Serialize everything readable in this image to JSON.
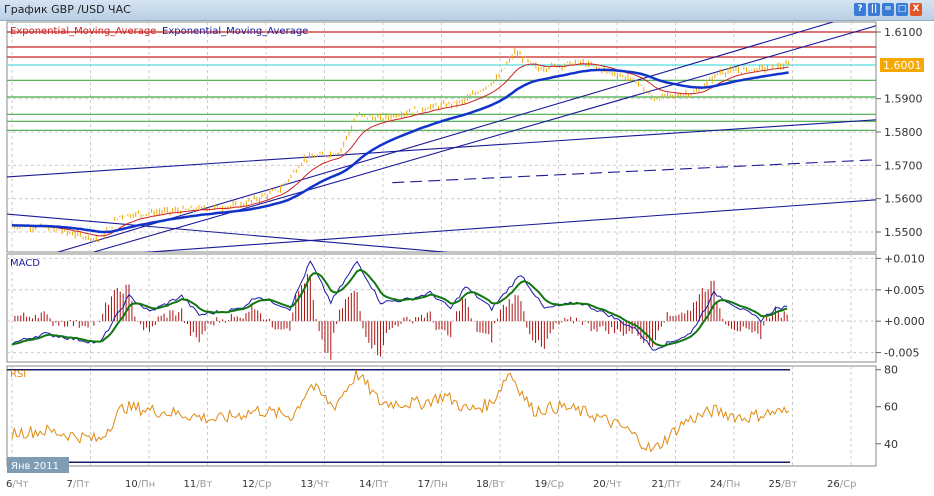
{
  "window": {
    "title": "График GBP /USD  ЧАС",
    "buttons": [
      "?",
      "||",
      "=",
      "□",
      "X"
    ]
  },
  "chart_data": [
    {
      "type": "line",
      "title": "GBP/USD",
      "legend": [
        "Exponential_Moving_Average",
        "Exponential_Moving_Average"
      ],
      "ylim": [
        1.544,
        1.613
      ],
      "y_ticks": [
        "1.6100",
        "1.5900",
        "1.5800",
        "1.5700",
        "1.5600",
        "1.5500"
      ],
      "current_price": "1.6001",
      "x_ticks": [
        {
          "d": "6",
          "w": "Чт"
        },
        {
          "d": "7",
          "w": "Пт"
        },
        {
          "d": "10",
          "w": "Пн"
        },
        {
          "d": "11",
          "w": "Вт"
        },
        {
          "d": "12",
          "w": "Ср"
        },
        {
          "d": "13",
          "w": "Чт"
        },
        {
          "d": "14",
          "w": "Пт"
        },
        {
          "d": "17",
          "w": "Пн"
        },
        {
          "d": "18",
          "w": "Вт"
        },
        {
          "d": "19",
          "w": "Ср"
        },
        {
          "d": "20",
          "w": "Чт"
        },
        {
          "d": "21",
          "w": "Пт"
        },
        {
          "d": "24",
          "w": "Пн"
        },
        {
          "d": "25",
          "w": "Вт"
        },
        {
          "d": "26",
          "w": "Ср"
        }
      ],
      "month_label": "Янв 2011",
      "price_path": [
        [
          0,
          1.552
        ],
        [
          0.5,
          1.5515
        ],
        [
          1.5,
          1.5478
        ],
        [
          1.85,
          1.555
        ],
        [
          2.9,
          1.5565
        ],
        [
          3.9,
          1.558
        ],
        [
          4.6,
          1.563
        ],
        [
          5.0,
          1.572
        ],
        [
          5.6,
          1.574
        ],
        [
          5.9,
          1.585
        ],
        [
          6.3,
          1.584
        ],
        [
          7.0,
          1.587
        ],
        [
          7.7,
          1.589
        ],
        [
          8.3,
          1.596
        ],
        [
          8.6,
          1.604
        ],
        [
          9.0,
          1.599
        ],
        [
          9.7,
          1.601
        ],
        [
          10.4,
          1.597
        ],
        [
          10.7,
          1.595
        ],
        [
          10.95,
          1.59
        ],
        [
          11.7,
          1.592
        ],
        [
          12.1,
          1.598
        ],
        [
          12.8,
          1.599
        ],
        [
          13.3,
          1.6001
        ]
      ],
      "hlines": [
        {
          "p": 1.61,
          "c": "#cc2222"
        },
        {
          "p": 1.6055,
          "c": "#cc2222"
        },
        {
          "p": 1.6025,
          "c": "#cc2222"
        },
        {
          "p": 1.6001,
          "c": "#55dddd"
        },
        {
          "p": 1.5955,
          "c": "#44aa44"
        },
        {
          "p": 1.5905,
          "c": "#44aa44"
        },
        {
          "p": 1.5853,
          "c": "#44aa44"
        },
        {
          "p": 1.5832,
          "c": "#44aa44"
        },
        {
          "p": 1.5805,
          "c": "#44aa44"
        }
      ],
      "trendlines": [
        {
          "a": [
            -0.1,
            1.5665
          ],
          "b": [
            14.8,
            1.5837
          ],
          "dash": false
        },
        {
          "a": [
            -0.1,
            1.5409
          ],
          "b": [
            14.8,
            1.5597
          ],
          "dash": false
        },
        {
          "a": [
            6.5,
            1.5648
          ],
          "b": [
            14.8,
            1.5717
          ],
          "dash": true
        },
        {
          "a": [
            -0.1,
            1.5554
          ],
          "b": [
            8.1,
            1.5429
          ],
          "dash": false
        },
        {
          "a": [
            1.4,
            1.544
          ],
          "b": [
            14.8,
            1.612
          ],
          "dash": false
        },
        {
          "a": [
            0.6,
            1.543
          ],
          "b": [
            14.8,
            1.617
          ],
          "dash": false
        }
      ]
    },
    {
      "type": "line",
      "title": "MACD",
      "ylim": [
        -0.0065,
        0.0107
      ],
      "y_ticks": [
        "+0.010",
        "+0.005",
        "+0.000",
        "-0.005"
      ],
      "path": [
        [
          0,
          -0.0035
        ],
        [
          0.55,
          -0.002
        ],
        [
          1.5,
          -0.0035
        ],
        [
          2.0,
          0.004
        ],
        [
          2.35,
          0.0015
        ],
        [
          2.9,
          0.004
        ],
        [
          3.2,
          0.001
        ],
        [
          3.9,
          0.002
        ],
        [
          4.2,
          0.004
        ],
        [
          4.75,
          0.002
        ],
        [
          5.1,
          0.0095
        ],
        [
          5.45,
          0.003
        ],
        [
          5.9,
          0.0095
        ],
        [
          6.3,
          0.003
        ],
        [
          6.8,
          0.0035
        ],
        [
          7.15,
          0.0045
        ],
        [
          7.5,
          0.002
        ],
        [
          7.75,
          0.0055
        ],
        [
          8.2,
          0.002
        ],
        [
          8.7,
          0.0075
        ],
        [
          9.1,
          0.002
        ],
        [
          9.7,
          0.003
        ],
        [
          10.2,
          0.001
        ],
        [
          10.7,
          -0.0015
        ],
        [
          10.95,
          -0.0045
        ],
        [
          11.6,
          -0.002
        ],
        [
          12.0,
          0.0045
        ],
        [
          12.45,
          0.002
        ],
        [
          12.8,
          0.0002
        ],
        [
          13.05,
          0.002
        ],
        [
          13.3,
          0.0022
        ]
      ]
    },
    {
      "type": "line",
      "title": "RSI",
      "ylim": [
        28,
        82
      ],
      "y_ticks": [
        "80",
        "60",
        "40"
      ],
      "path": [
        [
          0,
          46
        ],
        [
          0.6,
          47
        ],
        [
          1.5,
          42
        ],
        [
          1.9,
          60
        ],
        [
          2.9,
          56
        ],
        [
          3.5,
          53
        ],
        [
          4.2,
          58
        ],
        [
          4.8,
          55
        ],
        [
          5.1,
          72
        ],
        [
          5.5,
          60
        ],
        [
          5.9,
          78
        ],
        [
          6.3,
          62
        ],
        [
          7.0,
          62
        ],
        [
          7.4,
          66
        ],
        [
          7.8,
          58
        ],
        [
          8.2,
          62
        ],
        [
          8.5,
          79
        ],
        [
          8.9,
          58
        ],
        [
          9.4,
          60
        ],
        [
          9.9,
          56
        ],
        [
          10.5,
          48
        ],
        [
          10.95,
          36
        ],
        [
          11.5,
          52
        ],
        [
          12.0,
          58
        ],
        [
          12.5,
          54
        ],
        [
          13.0,
          57
        ],
        [
          13.3,
          57
        ]
      ]
    }
  ]
}
